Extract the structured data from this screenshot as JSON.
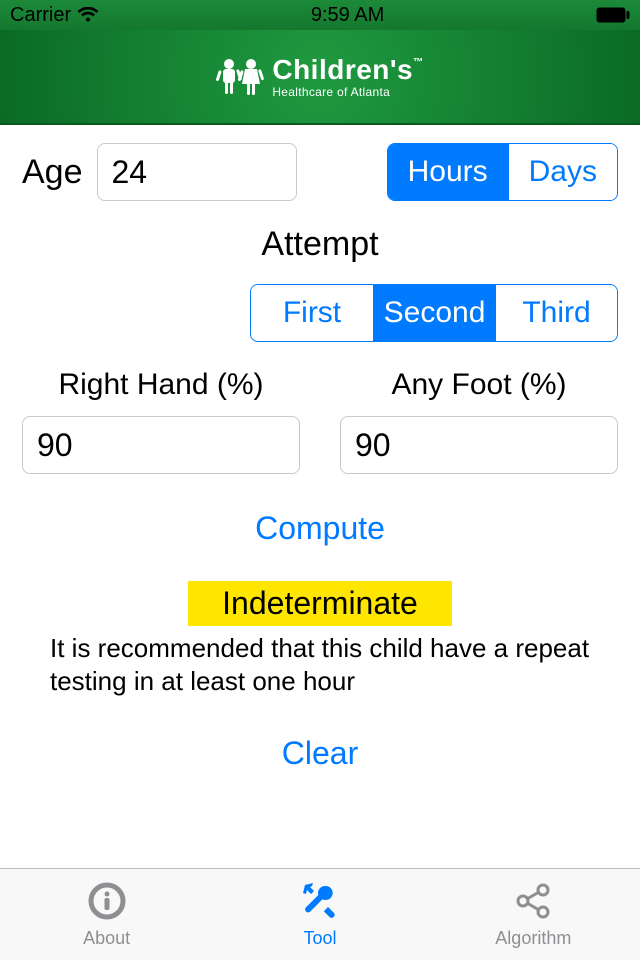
{
  "statusbar": {
    "carrier": "Carrier",
    "time": "9:59 AM"
  },
  "brand": {
    "name": "Children's",
    "tagline": "Healthcare of Atlanta"
  },
  "age": {
    "label": "Age",
    "value": "24"
  },
  "age_unit": {
    "hours": "Hours",
    "days": "Days",
    "selected": "Hours"
  },
  "attempt": {
    "title": "Attempt",
    "options": {
      "first": "First",
      "second": "Second",
      "third": "Third"
    },
    "selected": "Second"
  },
  "right_hand": {
    "label": "Right Hand (%)",
    "value": "90"
  },
  "any_foot": {
    "label": "Any Foot (%)",
    "value": "90"
  },
  "actions": {
    "compute": "Compute",
    "clear": "Clear"
  },
  "result": {
    "status": "Indeterminate",
    "message": "It is recommended that this child have a repeat testing in at least one hour",
    "bg": "#ffe600"
  },
  "tabs": {
    "about": "About",
    "tool": "Tool",
    "algorithm": "Algorithm",
    "selected": "Tool"
  }
}
